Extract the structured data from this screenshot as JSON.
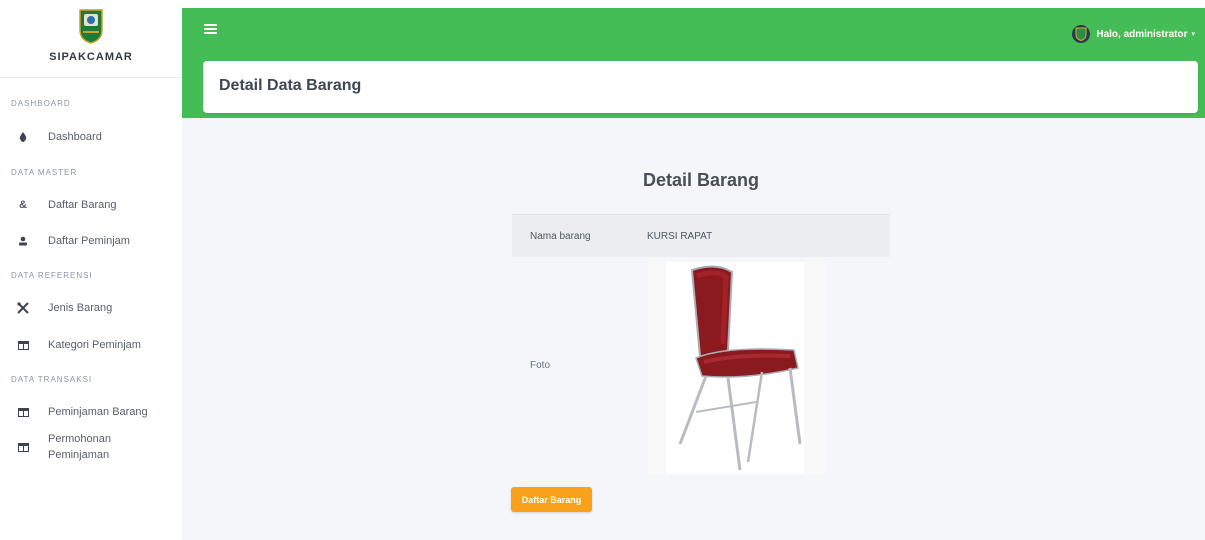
{
  "app": {
    "name": "SIPAKCAMAR",
    "logo_icon": "provincial-emblem-icon"
  },
  "topbar": {
    "menu_icon": "hamburger-icon",
    "user_greeting": "Halo, administrator",
    "caret": "▾",
    "accent_color": "#45bd56"
  },
  "sidebar": {
    "sections": [
      {
        "heading": "DASHBOARD",
        "items": [
          {
            "label": "Dashboard",
            "icon": "droplet-icon"
          }
        ]
      },
      {
        "heading": "DATA MASTER",
        "items": [
          {
            "label": "Daftar Barang",
            "icon": "ampersand-icon"
          },
          {
            "label": "Daftar Peminjam",
            "icon": "user-icon"
          }
        ]
      },
      {
        "heading": "DATA REFERENSI",
        "items": [
          {
            "label": "Jenis Barang",
            "icon": "tools-icon"
          },
          {
            "label": "Kategori Peminjam",
            "icon": "table-icon"
          }
        ]
      },
      {
        "heading": "DATA TRANSAKSI",
        "items": [
          {
            "label": "Peminjaman Barang",
            "icon": "table-icon"
          },
          {
            "label": "Permohonan Peminjaman",
            "icon": "table-icon"
          }
        ]
      }
    ]
  },
  "page": {
    "title": "Detail Data Barang"
  },
  "detail": {
    "title": "Detail Barang",
    "rows": [
      {
        "label": "Nama barang",
        "value": "KURSI RAPAT"
      },
      {
        "label": "Foto",
        "value": "chair-photo"
      }
    ],
    "button_label": "Daftar Barang",
    "button_color": "#f9a11b"
  }
}
